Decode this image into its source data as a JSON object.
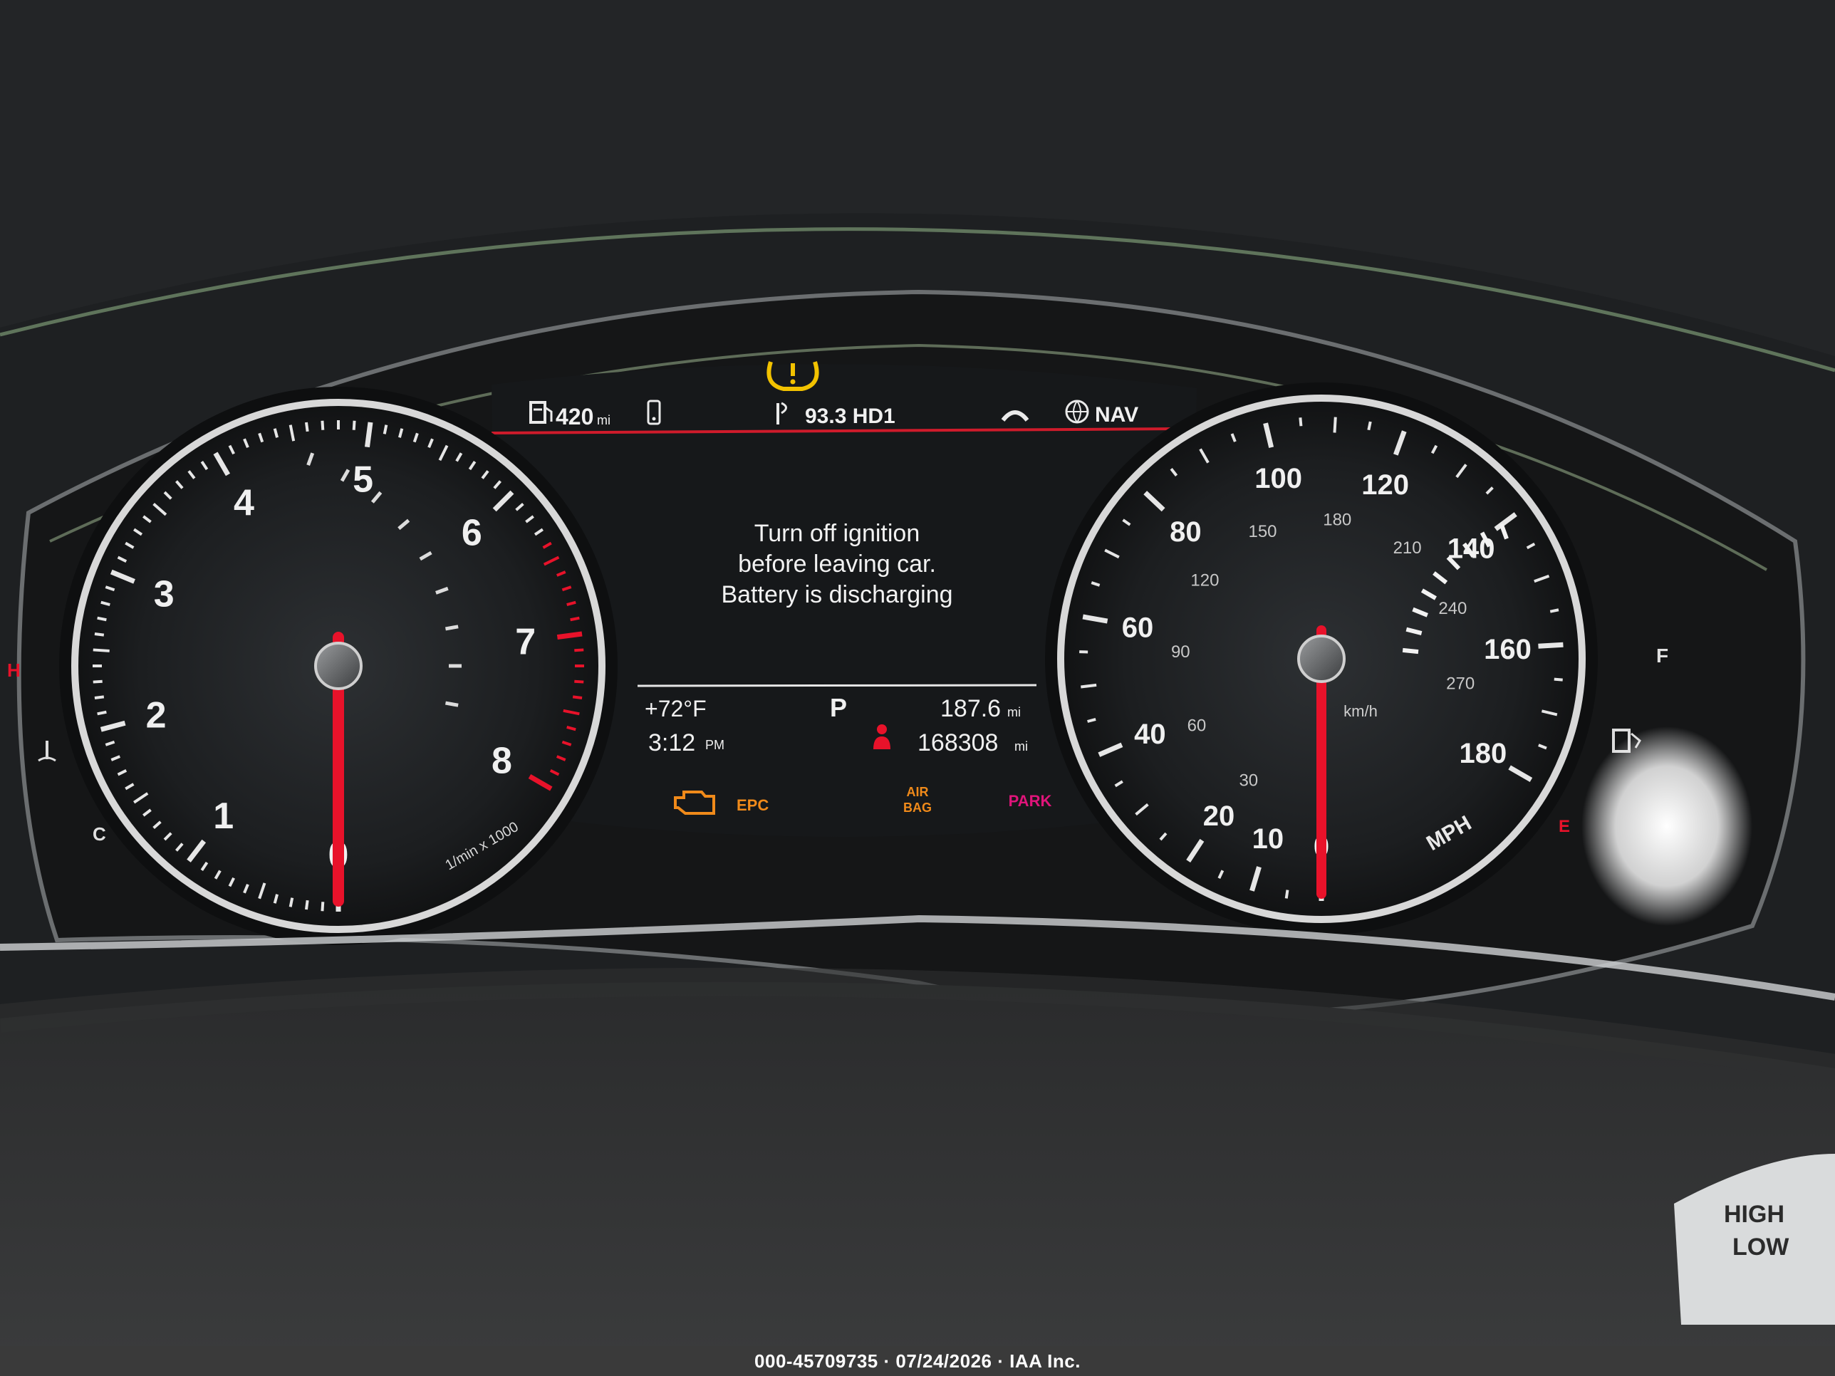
{
  "tachometer": {
    "labels": [
      "0",
      "1",
      "2",
      "3",
      "4",
      "5",
      "6",
      "7",
      "8"
    ],
    "unit": "1/min x 1000",
    "reading": 0
  },
  "speedometer": {
    "mph_labels": [
      "0",
      "10",
      "20",
      "40",
      "60",
      "80",
      "100",
      "120",
      "140",
      "160",
      "180"
    ],
    "kmh_labels": [
      "30",
      "60",
      "90",
      "120",
      "150",
      "180",
      "210",
      "240",
      "270"
    ],
    "kmh_unit": "km/h",
    "unit": "MPH",
    "reading": 0
  },
  "temp_gauge": {
    "hot": "H",
    "cold": "C"
  },
  "fuel_gauge": {
    "full": "F",
    "empty": "E"
  },
  "display": {
    "range": "420",
    "range_unit": "mi",
    "radio": "93.3 HD1",
    "nav": "NAV",
    "message_lines": [
      "Turn off ignition",
      "before leaving car.",
      "Battery is discharging"
    ],
    "outside_temp": "+72°F",
    "clock": "3:12",
    "clock_suffix": "PM",
    "gear": "P",
    "trip": "187.6",
    "trip_unit": "mi",
    "odometer": "168308",
    "odometer_unit": "mi"
  },
  "warnings": {
    "epc": "EPC",
    "airbag_line1": "AIR",
    "airbag_line2": "BAG",
    "park": "PARK"
  },
  "stalk": {
    "high": "HIGH",
    "low": "LOW"
  },
  "footer": "000-45709735 · 07/24/2026 · IAA Inc.",
  "colors": {
    "needle": "#e8122a",
    "amber": "#f08a1a",
    "tpms": "#f2c200",
    "park": "#e0147a",
    "divider": "#cf1b2b"
  }
}
